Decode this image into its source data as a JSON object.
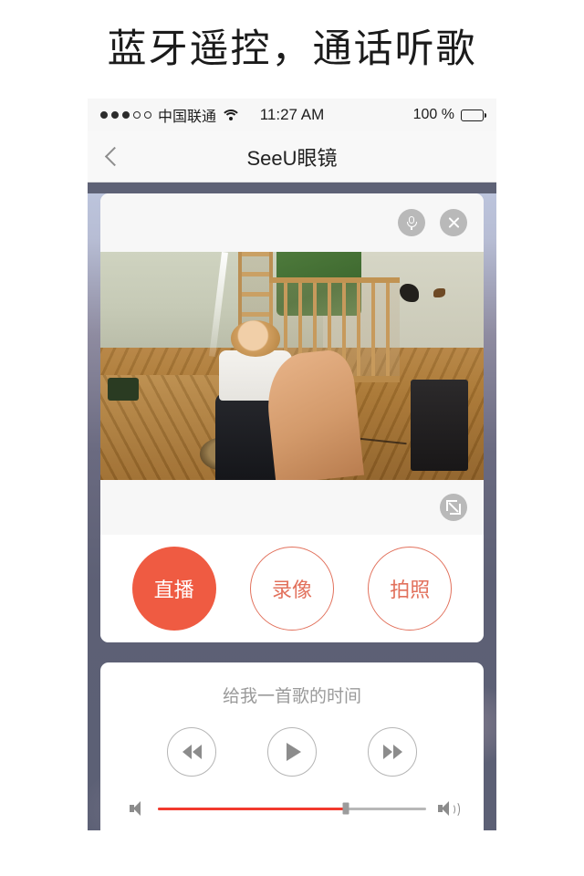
{
  "headline": "蓝牙遥控，通话听歌",
  "status_bar": {
    "signal_dots_total": 5,
    "signal_dots_filled": 3,
    "carrier": "中国联通",
    "wifi_icon": "wifi-icon",
    "time": "11:27 AM",
    "battery_percent": "100 %",
    "battery_level": 100
  },
  "nav_bar": {
    "back_icon": "chevron-left-icon",
    "title": "SeeU眼镜"
  },
  "video_card": {
    "mic_icon": "microphone-icon",
    "close_icon": "close-icon",
    "fullscreen_icon": "expand-icon"
  },
  "actions": [
    {
      "label": "直播",
      "style": "primary"
    },
    {
      "label": "录像",
      "style": "outline"
    },
    {
      "label": "拍照",
      "style": "outline"
    }
  ],
  "music": {
    "song_title": "给我一首歌的时间",
    "prev_icon": "rewind-icon",
    "play_icon": "play-icon",
    "next_icon": "fast-forward-icon",
    "volume_low_icon": "volume-mute-icon",
    "volume_high_icon": "volume-up-icon",
    "volume_percent": 70
  },
  "colors": {
    "accent": "#ef5b42",
    "accent_outline": "#e2715c",
    "slider_fill": "#f23a2e",
    "background_top": "#bcc4dc",
    "background_bottom": "#5c6075"
  }
}
